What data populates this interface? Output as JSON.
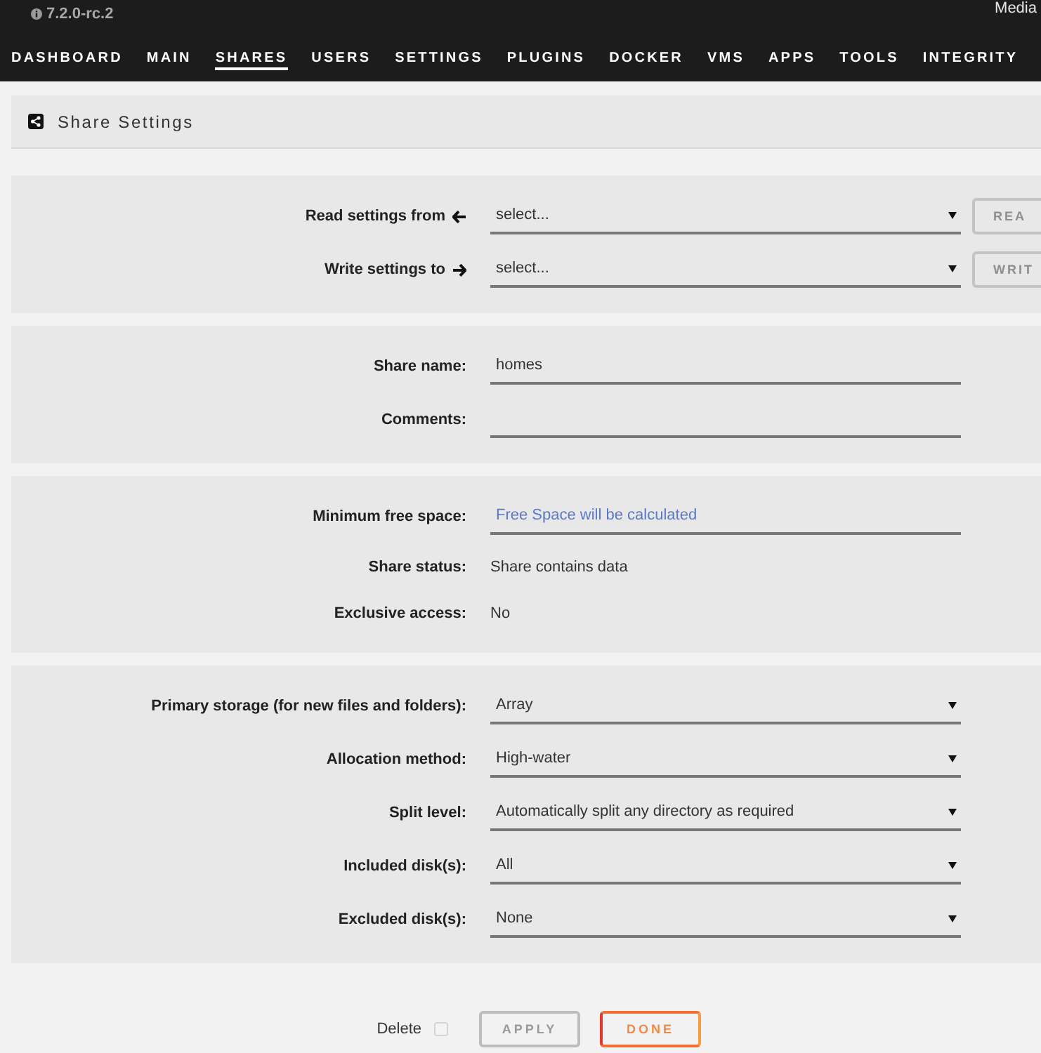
{
  "header": {
    "version": "7.2.0-rc.2",
    "server_name": "Media"
  },
  "nav": {
    "items": [
      {
        "label": "DASHBOARD",
        "selected": false
      },
      {
        "label": "MAIN",
        "selected": false
      },
      {
        "label": "SHARES",
        "selected": true
      },
      {
        "label": "USERS",
        "selected": false
      },
      {
        "label": "SETTINGS",
        "selected": false
      },
      {
        "label": "PLUGINS",
        "selected": false
      },
      {
        "label": "DOCKER",
        "selected": false
      },
      {
        "label": "VMS",
        "selected": false
      },
      {
        "label": "APPS",
        "selected": false
      },
      {
        "label": "TOOLS",
        "selected": false
      },
      {
        "label": "INTEGRITY",
        "selected": false
      }
    ]
  },
  "page_title": "Share Settings",
  "sections": [
    {
      "rows": [
        {
          "kind": "import",
          "label": "Read settings from",
          "value": "select...",
          "button": {
            "label": "REA",
            "disabled": true
          }
        },
        {
          "kind": "export",
          "label": "Write settings to",
          "value": "select...",
          "button": {
            "label": "WRIT",
            "disabled": true
          }
        }
      ]
    },
    {
      "rows": [
        {
          "kind": "text",
          "label": "Share name:",
          "value": "homes"
        },
        {
          "kind": "text",
          "label": "Comments:"
        }
      ]
    },
    {
      "rows": [
        {
          "kind": "text",
          "label": "Minimum free space:",
          "placeholder": "Free Space will be calculated"
        },
        {
          "kind": "info",
          "label": "Share status:",
          "value": "Share contains data"
        },
        {
          "kind": "info",
          "label": "Exclusive access:",
          "value": "No"
        }
      ]
    },
    {
      "rows": [
        {
          "kind": "select",
          "label": "Primary storage (for new files and folders):",
          "value": "Array"
        },
        {
          "kind": "select",
          "label": "Allocation method:",
          "value": "High-water"
        },
        {
          "kind": "select",
          "label": "Split level:",
          "value": "Automatically split any directory as required"
        },
        {
          "kind": "select",
          "label": "Included disk(s):",
          "value": "All"
        },
        {
          "kind": "select",
          "label": "Excluded disk(s):",
          "value": "None"
        }
      ]
    }
  ],
  "footer": {
    "delete": {
      "label": "Delete",
      "checked": false
    },
    "buttons": [
      {
        "kind": "secondary",
        "label": "APPLY",
        "disabled": true
      },
      {
        "kind": "primary",
        "label": "DONE",
        "disabled": false
      }
    ]
  }
}
